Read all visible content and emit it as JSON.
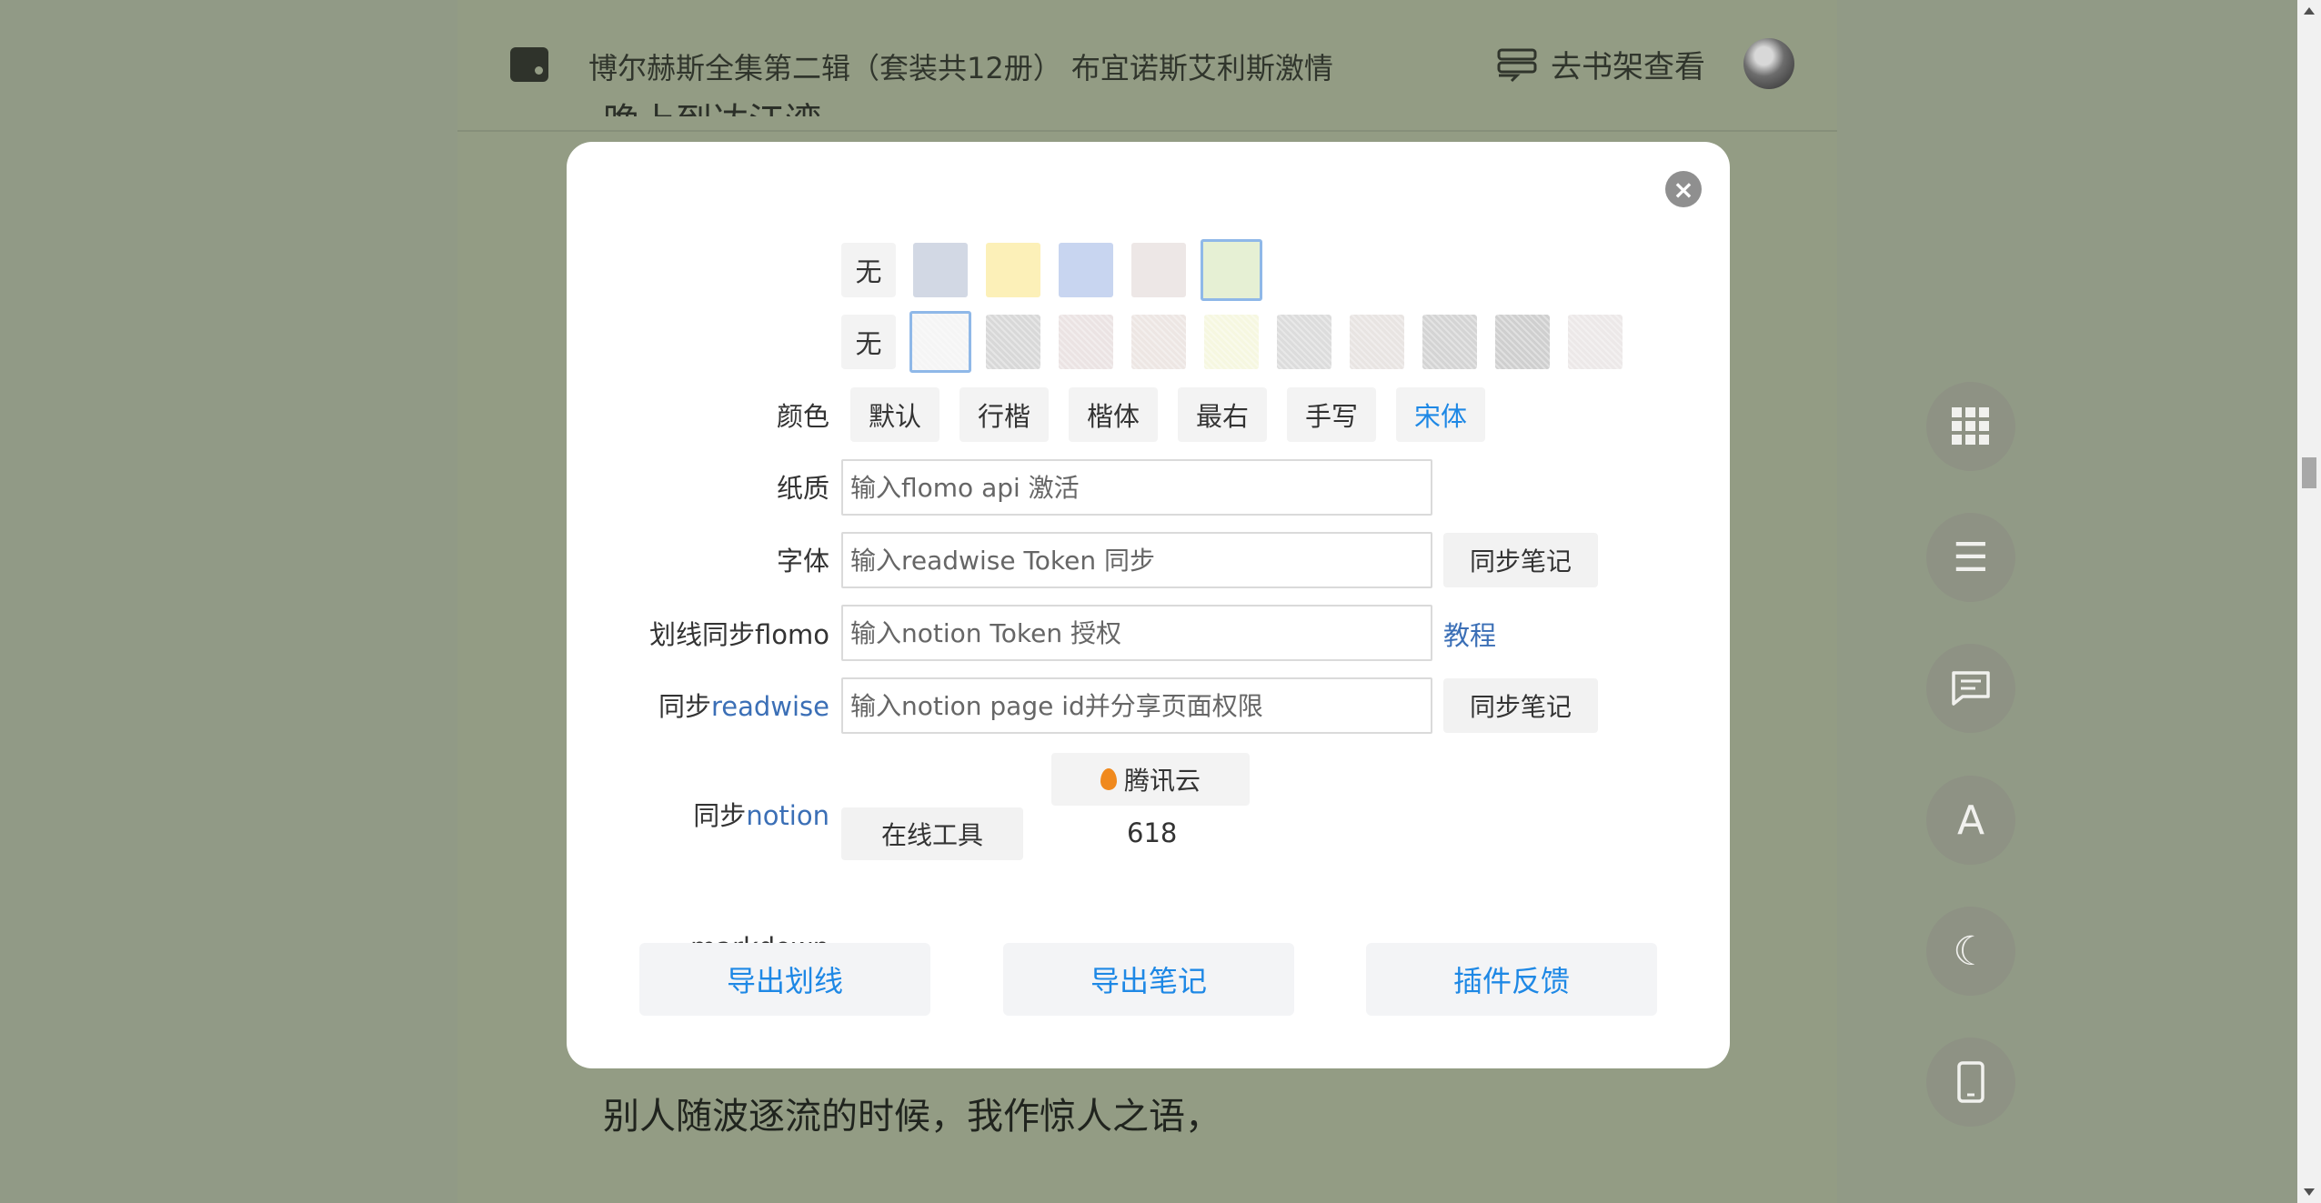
{
  "header": {
    "book_title": "博尔赫斯全集第二辑（套装共12册） 布宜诺斯艾利斯激情",
    "shelf_label": "去书架查看"
  },
  "reader": {
    "peek_text": "晚上到达江湾",
    "bottom_text": "别人随波逐流的时候，我作惊人之语，"
  },
  "side_buttons": [
    {
      "icon": "grid-icon"
    },
    {
      "icon": "menu-icon",
      "glyph": "☰"
    },
    {
      "icon": "comment-icon"
    },
    {
      "icon": "font-icon",
      "glyph": "A"
    },
    {
      "icon": "moon-icon",
      "glyph": "☾"
    },
    {
      "icon": "phone-icon"
    }
  ],
  "settings": {
    "color": {
      "label": "颜色",
      "none_label": "无",
      "swatches": [
        "#d2d8e4",
        "#fcf0b8",
        "#c8d5f0",
        "#ede7e6",
        "#e6f0d4"
      ],
      "selected_index": 4
    },
    "paper": {
      "label": "纸质",
      "none_label": "无",
      "textures": [
        "#f5f5f5",
        "#d8d8d8",
        "#ebe3e3",
        "#ede6e3",
        "#f6f7e0",
        "#dcdcdc",
        "#e8e4e2",
        "#d4d4d4",
        "#cfcfcf",
        "#ece8e8"
      ],
      "selected_index": 0
    },
    "font": {
      "label": "字体",
      "options": [
        "默认",
        "行楷",
        "楷体",
        "最右",
        "手写",
        "宋体"
      ],
      "active": "宋体"
    },
    "flomo": {
      "label": "划线同步flomo",
      "placeholder": "输入flomo api 激活"
    },
    "readwise": {
      "label_prefix": "同步",
      "label_link": "readwise",
      "placeholder": "输入readwise Token 同步",
      "button": "同步笔记"
    },
    "notion": {
      "label_prefix": "同步",
      "label_link": "notion",
      "token_placeholder": "输入notion Token 授权",
      "tutorial_link": "教程",
      "page_placeholder": "输入notion page id并分享页面权限",
      "button": "同步笔记"
    },
    "markdown": {
      "label": "markdown",
      "cloud_button": "腾讯云",
      "tool_button": "在线工具",
      "promo_number": "618"
    },
    "actions": [
      "导出划线",
      "导出笔记",
      "插件反馈"
    ]
  },
  "colors": {
    "accent_blue": "#1e88e5",
    "link_blue": "#3b6fb6",
    "page_background": "#939c84"
  }
}
